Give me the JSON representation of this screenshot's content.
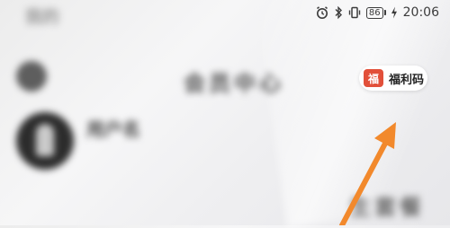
{
  "background": {
    "title_text": "我的",
    "menu_title": "会员中心",
    "profile_name": "用户名",
    "profile_sub_left": "",
    "profile_sub_right": "",
    "tab_left": "",
    "tab_middle": "",
    "tab_right": "生套餐"
  },
  "status_bar": {
    "battery_level": "86",
    "time": "20:06",
    "icons": [
      "alarm-icon",
      "bluetooth-icon",
      "vibrate-icon",
      "battery-icon",
      "charging-icon"
    ]
  },
  "welfare_button": {
    "icon_glyph": "福",
    "label": "福利码",
    "icon_color": "#e2503a"
  },
  "annotation": {
    "arrow_color": "#f2892c"
  }
}
